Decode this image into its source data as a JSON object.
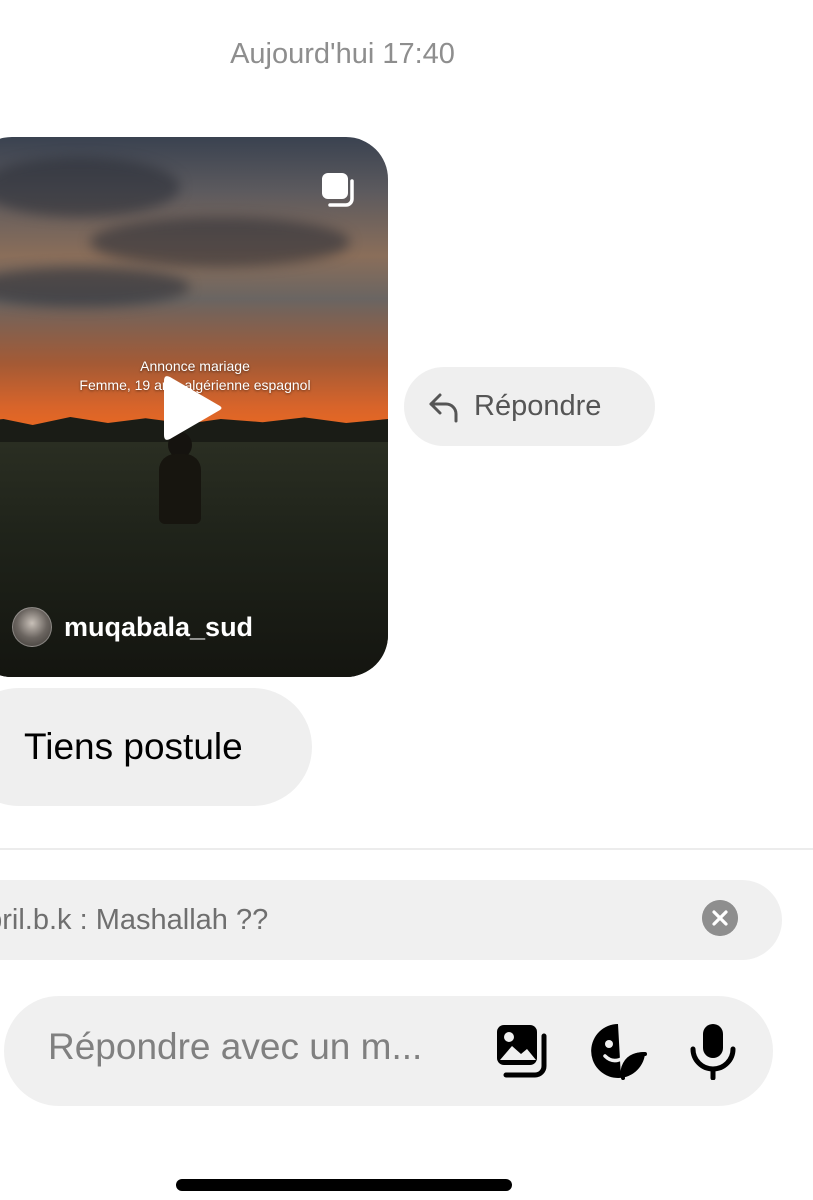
{
  "thread": {
    "timestamp": "Aujourd'hui 17:40"
  },
  "reel": {
    "overlay_line1": "Annonce mariage",
    "overlay_line2": "Femme, 19 ans, algérienne espagnol",
    "username": "muqabala_sud",
    "icons": {
      "multi": "multiple-media-icon",
      "play": "play-icon",
      "avatar": "avatar"
    }
  },
  "reply_button": {
    "label": "Répondre",
    "icon": "reply-arrow-icon"
  },
  "messages": [
    {
      "text": "Tiens postule"
    }
  ],
  "quote": {
    "text": "abril.b.k : Mashallah ??",
    "close_icon": "close-icon"
  },
  "composer": {
    "placeholder": "Répondre avec un m...",
    "icons": [
      "gallery-icon",
      "sticker-icon",
      "microphone-icon"
    ]
  },
  "colors": {
    "bubble": "#efefef",
    "secondary_text": "#8e8e8e",
    "primary_text": "#000000"
  }
}
